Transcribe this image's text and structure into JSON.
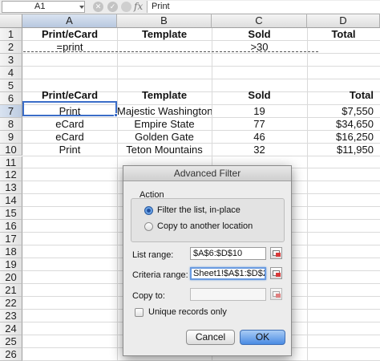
{
  "formula_bar": {
    "name_box": "A1",
    "cancel_icon": "✕",
    "confirm_icon": "✓",
    "fx_label": "fx",
    "content": "Print"
  },
  "columns": [
    "A",
    "B",
    "C",
    "D"
  ],
  "rows": [
    "1",
    "2",
    "3",
    "4",
    "5",
    "6",
    "7",
    "8",
    "9",
    "10",
    "11",
    "12",
    "13",
    "14",
    "15",
    "16",
    "17",
    "18",
    "19",
    "20",
    "21",
    "22",
    "23",
    "24",
    "25",
    "26"
  ],
  "criteria": {
    "headers": [
      "Print/eCard",
      "Template",
      "Sold",
      "Total"
    ],
    "values": [
      "=print",
      "",
      ">30",
      ""
    ]
  },
  "table": {
    "headers": [
      "Print/eCard",
      "Template",
      "Sold",
      "Total"
    ],
    "rows": [
      [
        "Print",
        "Majestic Washington",
        "19",
        "$7,550"
      ],
      [
        "eCard",
        "Empire State",
        "77",
        "$34,650"
      ],
      [
        "eCard",
        "Golden Gate",
        "46",
        "$16,250"
      ],
      [
        "Print",
        "Teton Mountains",
        "32",
        "$11,950"
      ]
    ]
  },
  "dialog": {
    "title": "Advanced Filter",
    "action_label": "Action",
    "option_filter": "Filter the list, in-place",
    "option_copy": "Copy to another location",
    "list_range_label": "List range:",
    "list_range_value": "$A$6:$D$10",
    "criteria_range_label": "Criteria range:",
    "criteria_range_value": "Sheet1!$A$1:$D$2",
    "copy_to_label": "Copy to:",
    "copy_to_value": "",
    "unique_label": "Unique records only",
    "cancel_label": "Cancel",
    "ok_label": "OK"
  },
  "colors": {
    "selection_blue": "#3b6dc8",
    "default_button": "#4a8be3"
  }
}
